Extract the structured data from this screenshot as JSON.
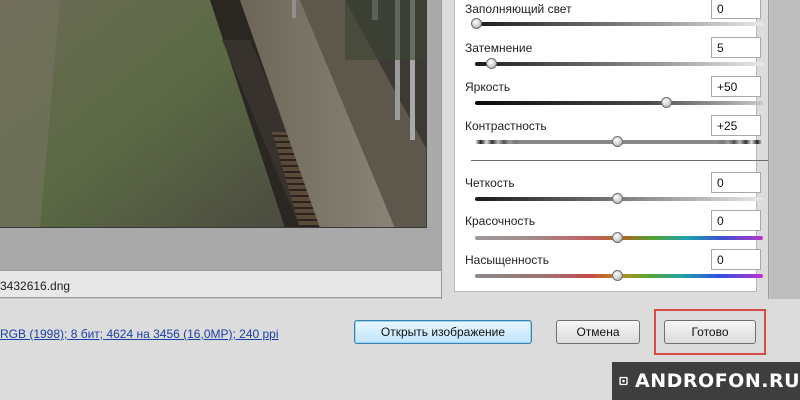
{
  "preview": {
    "file_name": "3432616.dng"
  },
  "adjustments": {
    "group1": [
      {
        "label": "Заполняющий свет",
        "value": "0",
        "level": 0
      },
      {
        "label": "Затемнение",
        "value": "5",
        "level": 5
      },
      {
        "label": "Яркость",
        "value": "+50",
        "level": 50
      },
      {
        "label": "Контрастность",
        "value": "+25",
        "level": 25
      }
    ],
    "group2": [
      {
        "label": "Четкость",
        "value": "0",
        "level": 0
      },
      {
        "label": "Красочность",
        "value": "0",
        "level": 0
      },
      {
        "label": "Насыщенность",
        "value": "0",
        "level": 0
      }
    ]
  },
  "workflow": {
    "info": "RGB (1998); 8 бит; 4624 на 3456 (16,0MP); 240 ppi"
  },
  "buttons": {
    "open_image": "Открыть изображение",
    "cancel": "Отмена",
    "done": "Готово"
  },
  "watermark": {
    "text": "ANDROFON.RU"
  },
  "colors": {
    "highlight": "#d8494a",
    "link": "#1b3fa8",
    "primary_button": "#bee6fd"
  }
}
